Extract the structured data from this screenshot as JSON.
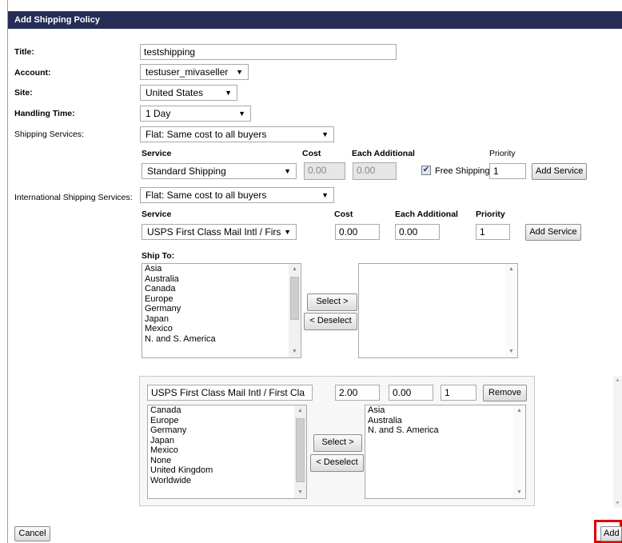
{
  "window": {
    "title": "Add Shipping Policy"
  },
  "form": {
    "title_label": "Title:",
    "title_value": "testshipping",
    "account_label": "Account:",
    "account_value": "testuser_mivaseller",
    "site_label": "Site:",
    "site_value": "United States",
    "handling_label": "Handling Time:",
    "handling_value": "1 Day"
  },
  "domestic": {
    "label": "Shipping Services:",
    "type_value": "Flat: Same cost to all buyers",
    "headers": {
      "service": "Service",
      "cost": "Cost",
      "each_additional": "Each Additional",
      "priority": "Priority"
    },
    "service_value": "Standard Shipping",
    "cost_value": "0.00",
    "each_value": "0.00",
    "free_shipping_label": "Free Shipping",
    "free_shipping_checked": true,
    "priority_value": "1",
    "add_service_label": "Add Service"
  },
  "international": {
    "label": "International Shipping Services:",
    "type_value": "Flat: Same cost to all buyers",
    "headers": {
      "service": "Service",
      "cost": "Cost",
      "each_additional": "Each Additional",
      "priority": "Priority"
    },
    "service_value": "USPS First Class Mail Intl / Firs",
    "cost_value": "0.00",
    "each_value": "0.00",
    "priority_value": "1",
    "add_service_label": "Add Service",
    "ship_to_label": "Ship To:",
    "available_regions": [
      "Asia",
      "Australia",
      "Canada",
      "Europe",
      "Germany",
      "Japan",
      "Mexico",
      "N. and S. America"
    ],
    "select_label": "Select >",
    "deselect_label": "< Deselect"
  },
  "added_service": {
    "service_value": "USPS First Class Mail Intl / First Cla",
    "cost_value": "2.00",
    "each_value": "0.00",
    "priority_value": "1",
    "remove_label": "Remove",
    "available_regions": [
      "Canada",
      "Europe",
      "Germany",
      "Japan",
      "Mexico",
      "None",
      "United Kingdom",
      "Worldwide"
    ],
    "selected_regions": [
      "Asia",
      "Australia",
      "N. and S. America"
    ],
    "select_label": "Select >",
    "deselect_label": "< Deselect"
  },
  "footer": {
    "cancel_label": "Cancel",
    "add_label": "Add"
  },
  "colors": {
    "titlebar": "#252d57",
    "highlight": "#e00000"
  }
}
